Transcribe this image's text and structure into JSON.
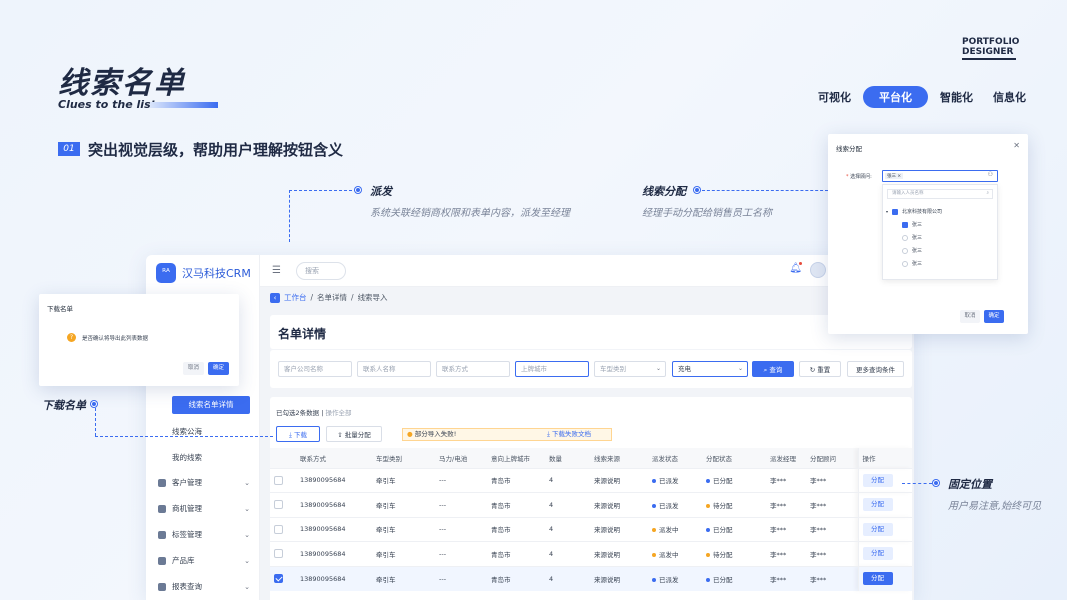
{
  "hero": {
    "title": "线索名单",
    "subtitle": "Clues to the list"
  },
  "logo": {
    "line1": "PORTFOLIO",
    "line2": "DESIGNER"
  },
  "categories": [
    {
      "label": "可视化",
      "active": false
    },
    {
      "label": "平台化",
      "active": true
    },
    {
      "label": "智能化",
      "active": false
    },
    {
      "label": "信息化",
      "active": false
    }
  ],
  "section": {
    "number": "01",
    "headline": "突出视觉层级，帮助用户理解按钮含义"
  },
  "annotations": {
    "dispatch": {
      "title": "派发",
      "desc": "系统关联经销商权限和表单内容，派发至经理"
    },
    "assign": {
      "title": "线索分配",
      "desc": "经理手动分配给销售员工名称"
    },
    "download": {
      "title": "下载名单"
    },
    "fixed": {
      "title": "固定位置",
      "desc": "用户易注意,始终可见"
    }
  },
  "app": {
    "brand": "汉马科技CRM",
    "brand_icon": "ᴿᴬ",
    "search_placeholder": "搜索",
    "breadcrumb": {
      "home": "工作台",
      "sep1": "/",
      "mid": "名单详情",
      "sep2": "/",
      "current": "线索导入"
    },
    "page_title": "名单详情",
    "sidebar": {
      "sub_items": [
        "线索名单详情",
        "线索公海",
        "我的线索"
      ],
      "groups": [
        "客户管理",
        "商机管理",
        "标签管理",
        "产品库",
        "报表查询"
      ]
    },
    "filters": {
      "company": "客户公司名称",
      "contact": "联系人名称",
      "phone": "联系方式",
      "city": "上牌城市",
      "vehicle_type": "车型类别",
      "power": "充电",
      "search_btn": "查询",
      "reset_btn": "重置",
      "more_btn": "更多查询条件"
    },
    "table_toolbar": {
      "selected": "已勾选2条数据",
      "op_all": "操作全部",
      "download_btn": "下载",
      "batch_btn": "批量分配",
      "warn_text": "部分导入失败!",
      "warn_link": "下载失败文档"
    },
    "columns": [
      "联系方式",
      "车型类别",
      "马力/电池",
      "意向上牌城市",
      "数量",
      "线索来源",
      "派发状态",
      "分配状态",
      "派发经理",
      "分配顾问",
      "操作"
    ],
    "rows": [
      {
        "phone": "13890095684",
        "type": "牵引车",
        "power": "---",
        "city": "青岛市",
        "qty": "4",
        "source": "来源说明",
        "dispatch": "已派发",
        "dispatch_color": "#3b6cf0",
        "assign": "已分配",
        "assign_color": "#3b6cf0",
        "manager": "李***",
        "advisor": "李***",
        "op": "分配",
        "checked": false
      },
      {
        "phone": "13890095684",
        "type": "牵引车",
        "power": "---",
        "city": "青岛市",
        "qty": "4",
        "source": "来源说明",
        "dispatch": "已派发",
        "dispatch_color": "#3b6cf0",
        "assign": "待分配",
        "assign_color": "#f5a623",
        "manager": "李***",
        "advisor": "李***",
        "op": "分配",
        "checked": false
      },
      {
        "phone": "13890095684",
        "type": "牵引车",
        "power": "---",
        "city": "青岛市",
        "qty": "4",
        "source": "来源说明",
        "dispatch": "派发中",
        "dispatch_color": "#f5a623",
        "assign": "已分配",
        "assign_color": "#3b6cf0",
        "manager": "李***",
        "advisor": "李***",
        "op": "分配",
        "checked": false
      },
      {
        "phone": "13890095684",
        "type": "牵引车",
        "power": "---",
        "city": "青岛市",
        "qty": "4",
        "source": "来源说明",
        "dispatch": "派发中",
        "dispatch_color": "#f5a623",
        "assign": "待分配",
        "assign_color": "#f5a623",
        "manager": "李***",
        "advisor": "李***",
        "op": "分配",
        "checked": false
      },
      {
        "phone": "13890095684",
        "type": "牵引车",
        "power": "---",
        "city": "青岛市",
        "qty": "4",
        "source": "来源说明",
        "dispatch": "已派发",
        "dispatch_color": "#3b6cf0",
        "assign": "已分配",
        "assign_color": "#3b6cf0",
        "manager": "李***",
        "advisor": "李***",
        "op": "分配",
        "checked": true
      }
    ]
  },
  "download_modal": {
    "title": "下载名单",
    "message": "是否确认将导出此列表数据",
    "cancel": "取消",
    "confirm": "确定"
  },
  "assign_modal": {
    "title": "线索分配",
    "label": "选择顾问:",
    "tag": "张三 ×",
    "search_placeholder": "请输入人员名称",
    "company": "北京科技有限公司",
    "people": [
      "张三",
      "张三",
      "张三",
      "张三"
    ],
    "cancel": "取消",
    "confirm": "确定"
  }
}
